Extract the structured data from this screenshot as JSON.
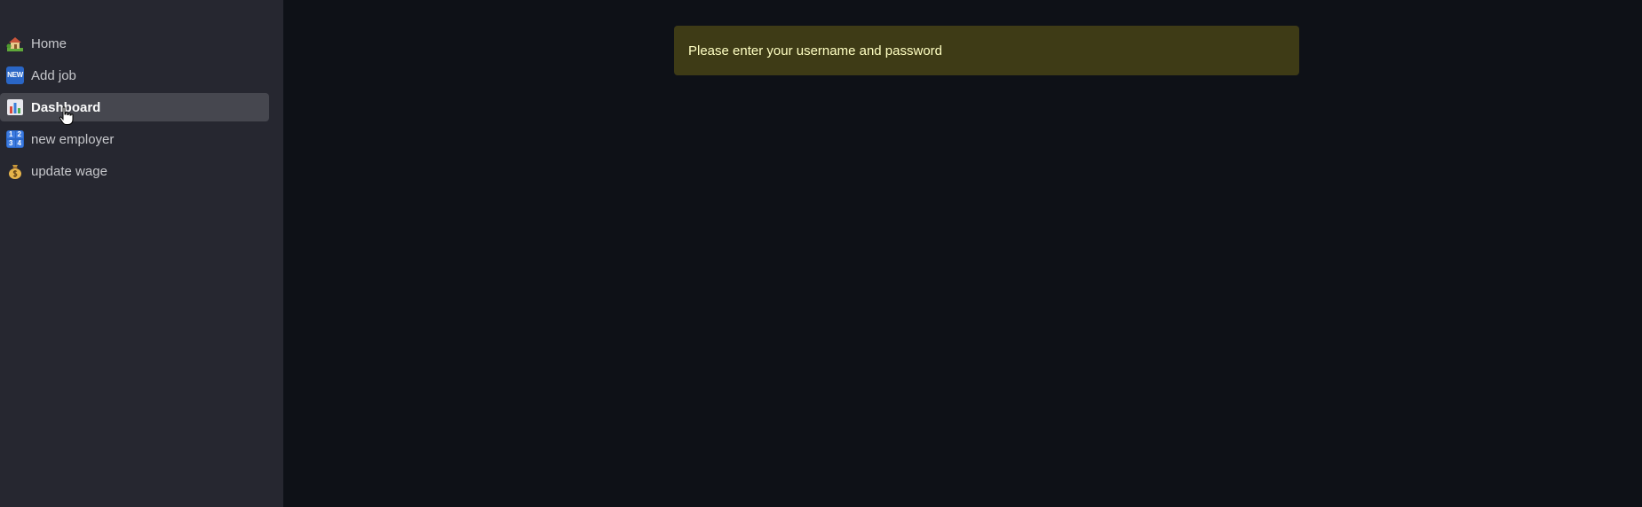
{
  "sidebar": {
    "items": [
      {
        "label": "Home",
        "icon": "house-with-garden-icon",
        "active": false
      },
      {
        "label": "Add job",
        "icon": "new-button-icon",
        "active": false
      },
      {
        "label": "Dashboard",
        "icon": "bar-chart-icon",
        "active": true
      },
      {
        "label": "new employer",
        "icon": "input-numbers-icon",
        "active": false
      },
      {
        "label": "update wage",
        "icon": "money-bag-icon",
        "active": false
      }
    ],
    "new_badge": "NEW",
    "numbers_badge": [
      "1",
      "2",
      "3",
      "4"
    ]
  },
  "main": {
    "alert": {
      "message": "Please enter your username and password",
      "type": "warning"
    }
  },
  "colors": {
    "background": "#0e1117",
    "sidebar": "#262730",
    "active_item": "#46474f",
    "alert_background": "#3e3b16",
    "alert_text": "#ffffc2"
  }
}
